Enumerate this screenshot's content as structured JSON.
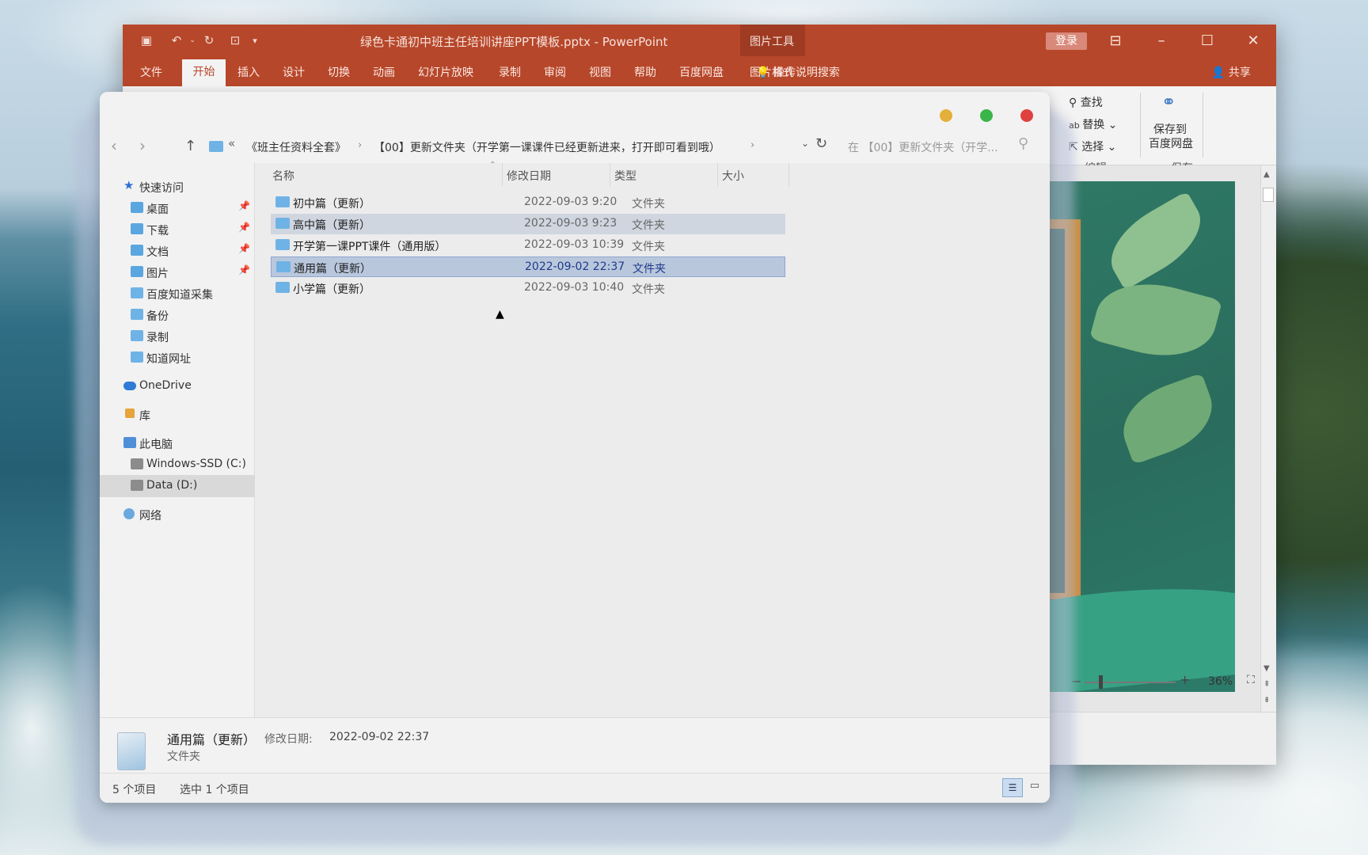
{
  "powerpoint": {
    "title": "绿色卡通初中班主任培训讲座PPT模板.pptx  -  PowerPoint",
    "picture_tools": "图片工具",
    "login": "登录",
    "tabs": [
      "文件",
      "开始",
      "插入",
      "设计",
      "切换",
      "动画",
      "幻灯片放映",
      "录制",
      "审阅",
      "视图",
      "帮助",
      "百度网盘",
      "图片格式"
    ],
    "tell_me": "操作说明搜索",
    "share": "共享",
    "ribbon": {
      "find": "查找",
      "replace": "替换",
      "select": "选择",
      "editing_group": "编辑",
      "save_to_baidu": "保存到",
      "save_to_baidu_2": "百度网盘",
      "save_group": "保存"
    },
    "zoom": "36%"
  },
  "explorer": {
    "breadcrumb": [
      "《班主任资料全套》",
      "【00】更新文件夹（开学第一课课件已经更新进来，打开即可看到哦）"
    ],
    "search_placeholder": "在 【00】更新文件夹（开学...",
    "columns": [
      "名称",
      "修改日期",
      "类型",
      "大小"
    ],
    "nav": {
      "quick_access": "快速访问",
      "desktop": "桌面",
      "downloads": "下载",
      "documents": "文档",
      "pictures": "图片",
      "baidu_collect": "百度知道采集",
      "backup": "备份",
      "recording": "录制",
      "zhidao_url": "知道网址",
      "onedrive": "OneDrive",
      "library": "库",
      "this_pc": "此电脑",
      "drive_c": "Windows-SSD (C:)",
      "drive_d": "Data (D:)",
      "network": "网络"
    },
    "files": [
      {
        "name": "初中篇（更新）",
        "date": "2022-09-03 9:20",
        "type": "文件夹"
      },
      {
        "name": "高中篇（更新）",
        "date": "2022-09-03 9:23",
        "type": "文件夹"
      },
      {
        "name": "开学第一课PPT课件（通用版）",
        "date": "2022-09-03 10:39",
        "type": "文件夹"
      },
      {
        "name": "通用篇（更新）",
        "date": "2022-09-02 22:37",
        "type": "文件夹"
      },
      {
        "name": "小学篇（更新）",
        "date": "2022-09-03 10:40",
        "type": "文件夹"
      }
    ],
    "details": {
      "name": "通用篇（更新）",
      "date_label": "修改日期:",
      "date": "2022-09-02 22:37",
      "type": "文件夹"
    },
    "status": {
      "count": "5 个项目",
      "selected": "选中 1 个项目"
    }
  }
}
